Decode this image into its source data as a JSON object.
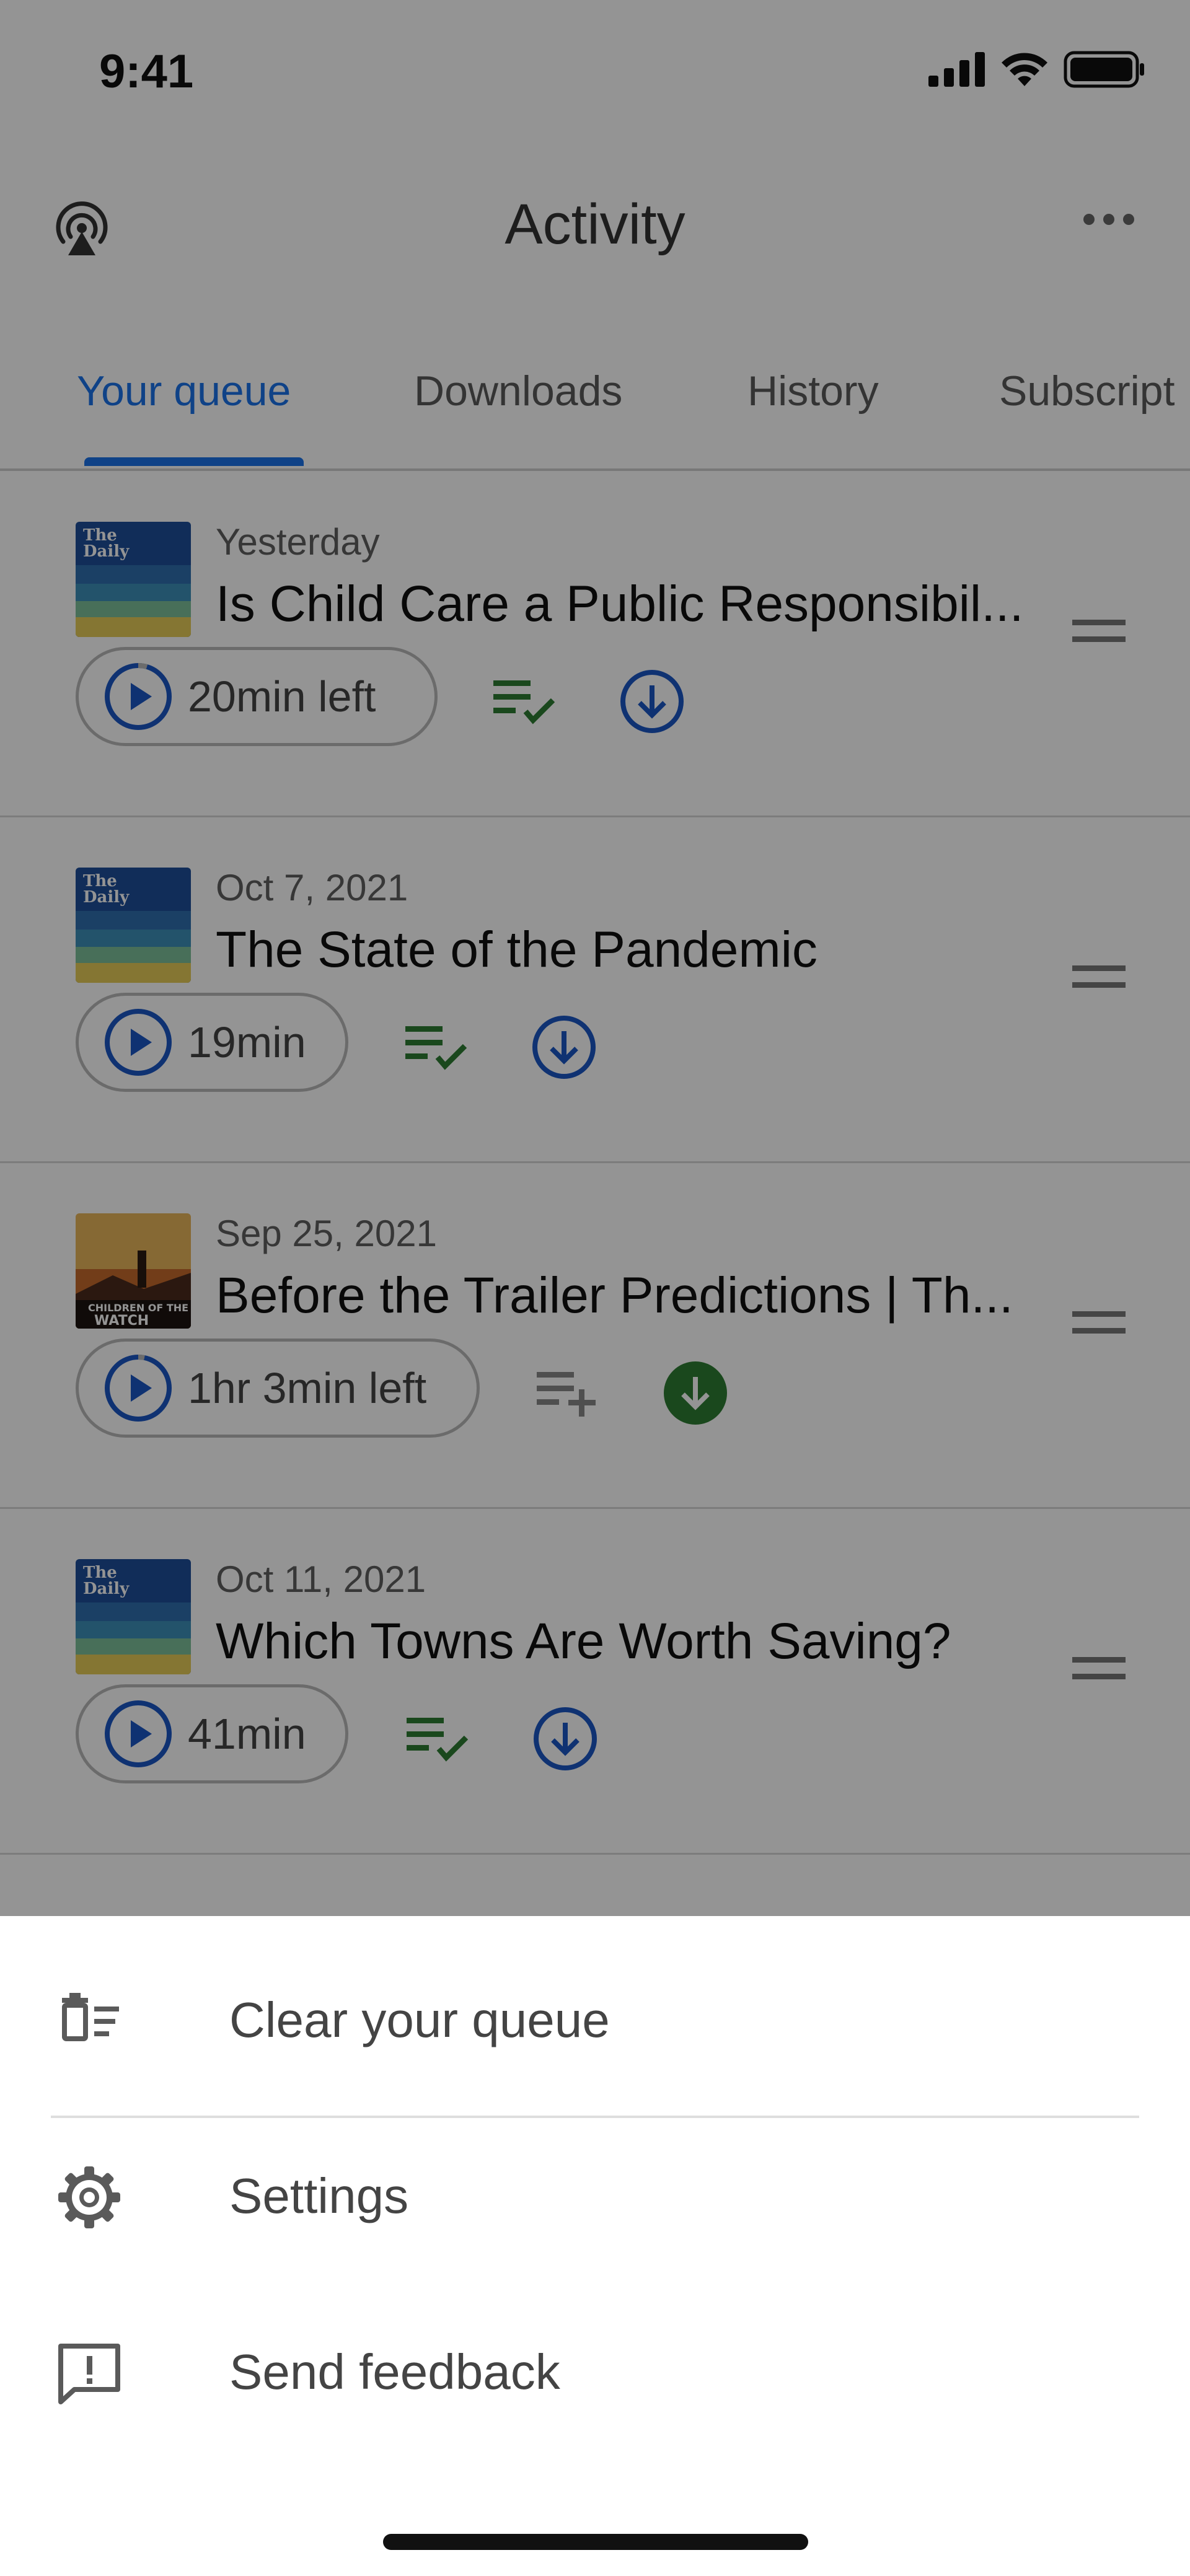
{
  "status_bar": {
    "time": "9:41"
  },
  "header": {
    "title": "Activity"
  },
  "tabs": [
    {
      "label": "Your queue",
      "active": true
    },
    {
      "label": "Downloads",
      "active": false
    },
    {
      "label": "History",
      "active": false
    },
    {
      "label": "Subscript",
      "active": false
    }
  ],
  "episodes": [
    {
      "date": "Yesterday",
      "title": "Is Child Care a Public Responsibil...",
      "duration": "20min left",
      "in_queue": true,
      "downloaded": false,
      "thumb": "The Daily"
    },
    {
      "date": "Oct 7, 2021",
      "title": "The State of the Pandemic",
      "duration": "19min",
      "in_queue": true,
      "downloaded": false,
      "thumb": "The Daily"
    },
    {
      "date": "Sep 25, 2021",
      "title": "Before the Trailer Predictions | Th...",
      "duration": "1hr 3min left",
      "in_queue": false,
      "downloaded": true,
      "thumb": "Children of the Watch"
    },
    {
      "date": "Oct 11, 2021",
      "title": "Which Towns Are Worth Saving?",
      "duration": "41min",
      "in_queue": true,
      "downloaded": false,
      "thumb": "The Daily"
    }
  ],
  "sheet": {
    "items": [
      {
        "label": "Clear your queue",
        "icon": "clear-queue-icon"
      },
      {
        "label": "Settings",
        "icon": "gear-icon"
      },
      {
        "label": "Send feedback",
        "icon": "feedback-icon"
      }
    ]
  },
  "colors": {
    "accent": "#1a73e8",
    "queued_green": "#2e7d32",
    "download_blue": "#1a56c4"
  }
}
